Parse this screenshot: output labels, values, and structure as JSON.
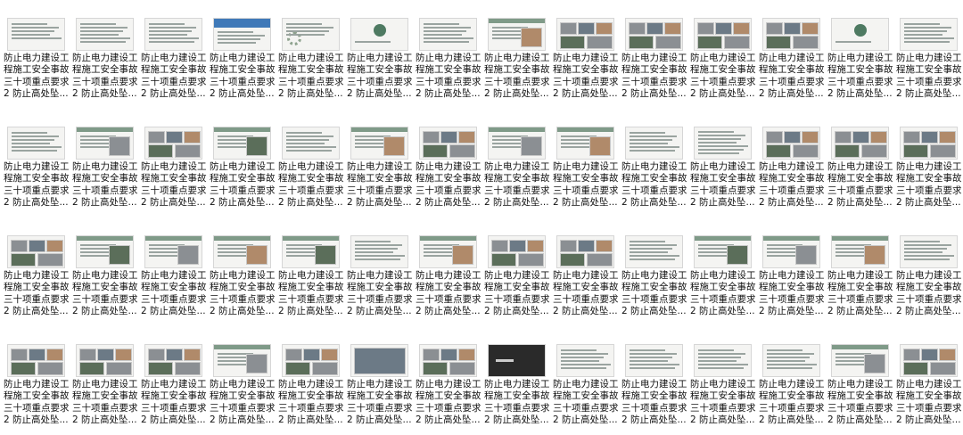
{
  "item_caption": {
    "line1": "防止电力建设工",
    "line2": "程施工安全事故",
    "line3": "三十项重点要求",
    "line4": "2 防止高处坠..."
  },
  "thumbnails": [
    {
      "style": "cover-text"
    },
    {
      "style": "text"
    },
    {
      "style": "text"
    },
    {
      "style": "blue-banner"
    },
    {
      "style": "gear"
    },
    {
      "style": "logo"
    },
    {
      "style": "text"
    },
    {
      "style": "text-photo"
    },
    {
      "style": "photo-grid"
    },
    {
      "style": "photo-grid"
    },
    {
      "style": "photo-grid"
    },
    {
      "style": "photo-grid"
    },
    {
      "style": "logo"
    },
    {
      "style": "text"
    },
    {
      "style": "text"
    },
    {
      "style": "text-photo"
    },
    {
      "style": "photo-grid"
    },
    {
      "style": "text-photo"
    },
    {
      "style": "text"
    },
    {
      "style": "text-photo"
    },
    {
      "style": "photo-grid"
    },
    {
      "style": "text-photo"
    },
    {
      "style": "text-photo"
    },
    {
      "style": "text"
    },
    {
      "style": "table"
    },
    {
      "style": "photo-grid"
    },
    {
      "style": "photo-grid"
    },
    {
      "style": "photo-grid"
    },
    {
      "style": "photo-grid"
    },
    {
      "style": "text-photo"
    },
    {
      "style": "text-photo"
    },
    {
      "style": "text-photo"
    },
    {
      "style": "text-photo"
    },
    {
      "style": "text"
    },
    {
      "style": "text-photo"
    },
    {
      "style": "photo-grid"
    },
    {
      "style": "photo-grid"
    },
    {
      "style": "text"
    },
    {
      "style": "text-photo"
    },
    {
      "style": "text-photo"
    },
    {
      "style": "text-photo"
    },
    {
      "style": "text"
    },
    {
      "style": "photo-grid"
    },
    {
      "style": "photo-grid"
    },
    {
      "style": "photo-grid"
    },
    {
      "style": "text-photo"
    },
    {
      "style": "photo-grid"
    },
    {
      "style": "dark-photo"
    },
    {
      "style": "photo-grid"
    },
    {
      "style": "dark"
    },
    {
      "style": "text"
    },
    {
      "style": "text"
    },
    {
      "style": "text"
    },
    {
      "style": "text"
    },
    {
      "style": "text-photo"
    },
    {
      "style": "photo-grid"
    }
  ]
}
